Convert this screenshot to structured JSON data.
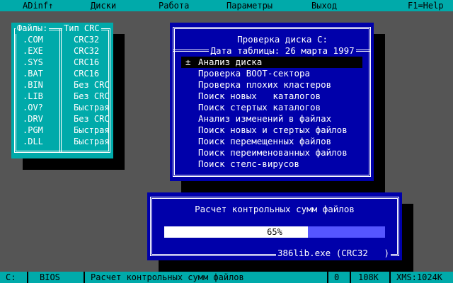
{
  "menu": {
    "items": [
      {
        "label": "ADinf↑"
      },
      {
        "label": "Диски"
      },
      {
        "label": "Работа"
      },
      {
        "label": "Параметры"
      },
      {
        "label": "Выход"
      },
      {
        "label": "F1=Help"
      }
    ]
  },
  "files_panel": {
    "header_ext": "Файлы:",
    "header_method": "Тип CRC",
    "rows": [
      {
        "ext": ".COM",
        "method": "CRC32"
      },
      {
        "ext": ".EXE",
        "method": "CRC32"
      },
      {
        "ext": ".SYS",
        "method": "CRC16"
      },
      {
        "ext": ".BAT",
        "method": "CRC16"
      },
      {
        "ext": ".BIN",
        "method": "Без CRC"
      },
      {
        "ext": ".LIB",
        "method": "Без CRC"
      },
      {
        "ext": ".OV?",
        "method": "Быстрая"
      },
      {
        "ext": ".DRV",
        "method": "Без CRC"
      },
      {
        "ext": ".PGM",
        "method": "Быстрая"
      },
      {
        "ext": ".DLL",
        "method": "Быстрая"
      }
    ]
  },
  "disk_panel": {
    "title": "Проверка диска C:",
    "date": "Дата таблицы: 26 марта 1997",
    "selected_marker": "±",
    "actions": [
      {
        "label": "Анализ диска",
        "selected": true
      },
      {
        "label": "Проверка BOOT-сектора",
        "selected": false
      },
      {
        "label": "Проверка плохих кластеров",
        "selected": false
      },
      {
        "label": "Поиск новых   каталогов",
        "selected": false
      },
      {
        "label": "Поиск стертых каталогов",
        "selected": false
      },
      {
        "label": "Анализ изменений в файлах",
        "selected": false
      },
      {
        "label": "Поиск новых и стертых файлов",
        "selected": false
      },
      {
        "label": "Поиск перемещенных файлов",
        "selected": false
      },
      {
        "label": "Поиск переименованных файлов",
        "selected": false
      },
      {
        "label": "Поиск стелс-вирусов",
        "selected": false
      }
    ]
  },
  "progress": {
    "caption": "Расчет контрольных сумм файлов",
    "percent_value": 65,
    "percent_text": "65%",
    "current_file": "386lib.exe (CRC32   )"
  },
  "status": {
    "drive": "C:",
    "bios": "BIOS",
    "message": "Расчет контрольных сумм файлов",
    "count": "0",
    "memory": "108K",
    "xms": "XMS:1024K"
  },
  "colors": {
    "background": "#555555",
    "cyan": "#00AAAA",
    "blue": "#0000AA",
    "light_blue": "#5555FF",
    "white": "#FFFFFF",
    "black": "#000000"
  }
}
